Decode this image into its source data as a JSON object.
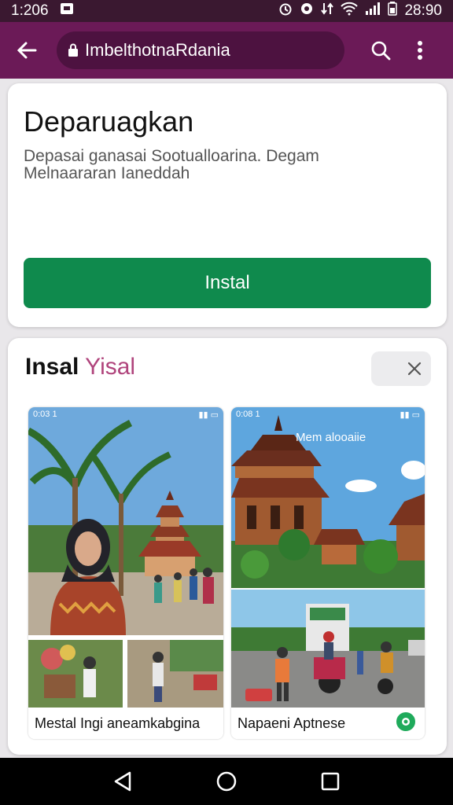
{
  "status_bar": {
    "time": "1:206",
    "clock_right": "28:90"
  },
  "app_bar": {
    "url": "ImbelthotnaRdania"
  },
  "app_card": {
    "title": "Deparuagkan",
    "description": "Depasai ganasai Sootualloarina. Degam Melnaararan Ianeddah",
    "install_label": "Instal"
  },
  "screenshots_section": {
    "title_part1": "Insal",
    "title_part2": "Yisal",
    "shots": [
      {
        "caption": "Mestal Ingi aneamkabgina",
        "mini_time": "0:03 1",
        "overlay": ""
      },
      {
        "caption": "Napaeni Aptnese",
        "mini_time": "0:08 1",
        "overlay": "Mem alooaiie"
      }
    ]
  },
  "colors": {
    "app_bar": "#6b1a57",
    "status_bar": "#3a1830",
    "install_button": "#0f8a4d",
    "accent_pink": "#b0447c"
  },
  "icons": [
    "back-arrow-icon",
    "lock-icon",
    "search-icon",
    "more-vert-icon",
    "close-icon",
    "nav-back-icon",
    "nav-home-icon",
    "nav-recents-icon"
  ]
}
